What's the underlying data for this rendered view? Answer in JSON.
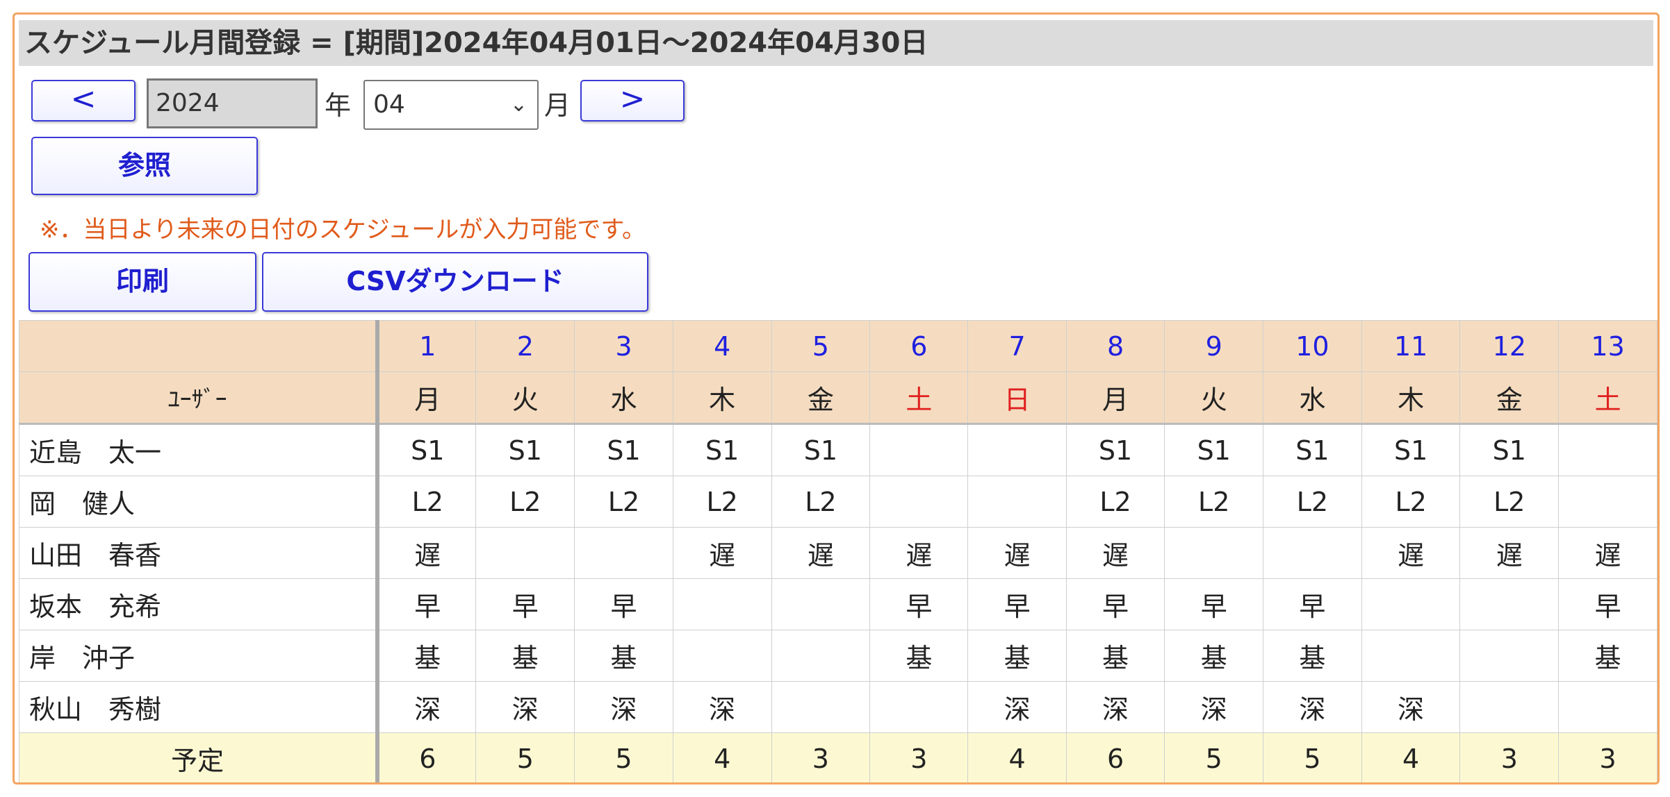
{
  "title": "スケジュール月間登録 = [期間]2024年04月01日～2024年04月30日",
  "nav": {
    "prev_label": "<",
    "next_label": ">",
    "year_value": "2024",
    "year_unit": "年",
    "month_value": "04",
    "month_unit": "月"
  },
  "buttons": {
    "refer_label": "参照",
    "print_label": "印刷",
    "csv_label": "CSVダウンロード"
  },
  "note": "※．当日より未来の日付のスケジュールが入力可能です。",
  "table": {
    "user_header": "ﾕｰｻﾞｰ",
    "days": [
      {
        "num": "1",
        "wd": "月",
        "holiday": false
      },
      {
        "num": "2",
        "wd": "火",
        "holiday": false
      },
      {
        "num": "3",
        "wd": "水",
        "holiday": false
      },
      {
        "num": "4",
        "wd": "木",
        "holiday": false
      },
      {
        "num": "5",
        "wd": "金",
        "holiday": false
      },
      {
        "num": "6",
        "wd": "土",
        "holiday": true
      },
      {
        "num": "7",
        "wd": "日",
        "holiday": true
      },
      {
        "num": "8",
        "wd": "月",
        "holiday": false
      },
      {
        "num": "9",
        "wd": "火",
        "holiday": false
      },
      {
        "num": "10",
        "wd": "水",
        "holiday": false
      },
      {
        "num": "11",
        "wd": "木",
        "holiday": false
      },
      {
        "num": "12",
        "wd": "金",
        "holiday": false
      },
      {
        "num": "13",
        "wd": "土",
        "holiday": true
      }
    ],
    "rows": [
      {
        "name": "近島　太一",
        "cells": [
          "S1",
          "S1",
          "S1",
          "S1",
          "S1",
          "",
          "",
          "S1",
          "S1",
          "S1",
          "S1",
          "S1",
          ""
        ]
      },
      {
        "name": "岡　健人",
        "cells": [
          "L2",
          "L2",
          "L2",
          "L2",
          "L2",
          "",
          "",
          "L2",
          "L2",
          "L2",
          "L2",
          "L2",
          ""
        ]
      },
      {
        "name": "山田　春香",
        "cells": [
          "遅",
          "",
          "",
          "遅",
          "遅",
          "遅",
          "遅",
          "遅",
          "",
          "",
          "遅",
          "遅",
          "遅"
        ]
      },
      {
        "name": "坂本　充希",
        "cells": [
          "早",
          "早",
          "早",
          "",
          "",
          "早",
          "早",
          "早",
          "早",
          "早",
          "",
          "",
          "早"
        ]
      },
      {
        "name": "岸　沖子",
        "cells": [
          "基",
          "基",
          "基",
          "",
          "",
          "基",
          "基",
          "基",
          "基",
          "基",
          "",
          "",
          "基"
        ]
      },
      {
        "name": "秋山　秀樹",
        "cells": [
          "深",
          "深",
          "深",
          "深",
          "",
          "",
          "深",
          "深",
          "深",
          "深",
          "深",
          "",
          ""
        ]
      }
    ],
    "summary": {
      "label": "予定",
      "values": [
        "6",
        "5",
        "5",
        "4",
        "3",
        "3",
        "4",
        "6",
        "5",
        "5",
        "4",
        "3",
        "3"
      ]
    }
  }
}
